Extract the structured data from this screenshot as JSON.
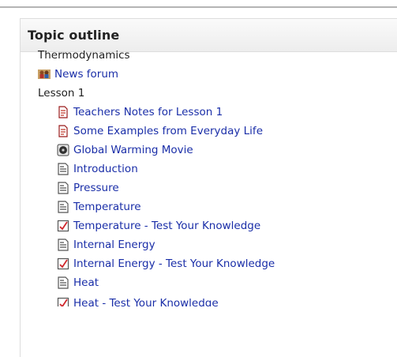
{
  "section_title": "Topic outline",
  "outline": {
    "heading": "Thermodynamics",
    "news_forum": "News forum",
    "lesson": "Lesson 1",
    "items": [
      {
        "label": "Teachers Notes for Lesson 1",
        "icon": "pdf-icon"
      },
      {
        "label": "Some Examples from Everyday Life",
        "icon": "pdf-icon"
      },
      {
        "label": "Global Warming Movie",
        "icon": "video-icon"
      },
      {
        "label": "Introduction",
        "icon": "page-icon"
      },
      {
        "label": "Pressure",
        "icon": "page-icon"
      },
      {
        "label": "Temperature",
        "icon": "page-icon"
      },
      {
        "label": "Temperature - Test Your Knowledge",
        "icon": "quiz-icon"
      },
      {
        "label": "Internal Energy",
        "icon": "page-icon"
      },
      {
        "label": "Internal Energy - Test Your Knowledge",
        "icon": "quiz-icon"
      },
      {
        "label": "Heat",
        "icon": "page-icon"
      },
      {
        "label": "Heat - Test Your Knowledge",
        "icon": "quiz-icon"
      }
    ]
  },
  "colors": {
    "link": "#1a2ea8",
    "text": "#1e1e1e",
    "header_bg": "#f0f0f0",
    "border": "#dddddd"
  }
}
